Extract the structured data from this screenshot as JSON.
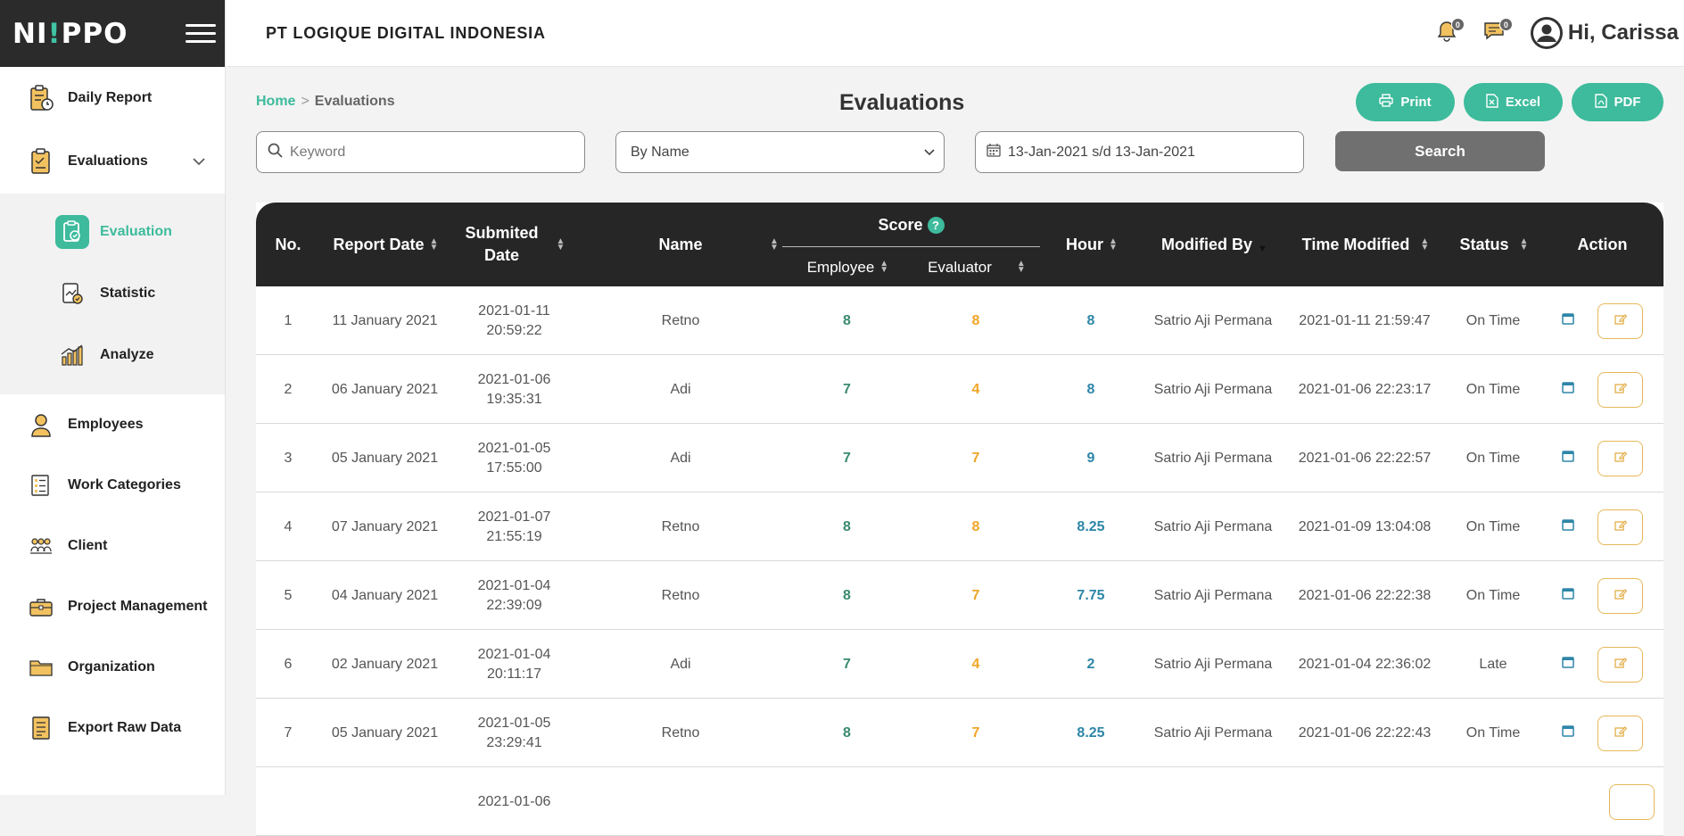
{
  "brand": {
    "logo_prefix": "NI",
    "logo_dot": "!",
    "logo_suffix": "PPO"
  },
  "sidebar": {
    "items": [
      {
        "label": "Daily Report"
      },
      {
        "label": "Evaluations"
      }
    ],
    "sub_items": [
      {
        "label": "Evaluation"
      },
      {
        "label": "Statistic"
      },
      {
        "label": "Analyze"
      }
    ],
    "lower_items": [
      {
        "label": "Employees"
      },
      {
        "label": "Work Categories"
      },
      {
        "label": "Client"
      },
      {
        "label": "Project Management"
      },
      {
        "label": "Organization"
      },
      {
        "label": "Export Raw Data"
      }
    ]
  },
  "header": {
    "company": "PT LOGIQUE DIGITAL INDONESIA",
    "notifications_count": "0",
    "messages_count": "0",
    "greeting": "Hi, Carissa"
  },
  "breadcrumb": {
    "home": "Home",
    "separator": ">",
    "current": "Evaluations"
  },
  "page": {
    "title": "Evaluations"
  },
  "exports": {
    "print": "Print",
    "excel": "Excel",
    "pdf": "PDF"
  },
  "filters": {
    "keyword_placeholder": "Keyword",
    "select_value": "By Name",
    "date_range": "13-Jan-2021 s/d 13-Jan-2021",
    "search_label": "Search"
  },
  "table": {
    "headers": {
      "no": "No.",
      "report_date": "Report Date",
      "submitted_date_1": "Submited",
      "submitted_date_2": "Date",
      "name": "Name",
      "score": "Score",
      "employee": "Employee",
      "evaluator": "Evaluator",
      "hour": "Hour",
      "modified_by": "Modified By",
      "time_modified": "Time Modified",
      "status": "Status",
      "action": "Action"
    },
    "rows": [
      {
        "no": "1",
        "report_date": "11 January 2021",
        "sub_date": "2021-01-11",
        "sub_time": "20:59:22",
        "name": "Retno",
        "employee": "8",
        "evaluator": "8",
        "hour": "8",
        "modified_by": "Satrio Aji Permana",
        "time_modified": "2021-01-11 21:59:47",
        "status": "On Time"
      },
      {
        "no": "2",
        "report_date": "06 January 2021",
        "sub_date": "2021-01-06",
        "sub_time": "19:35:31",
        "name": "Adi",
        "employee": "7",
        "evaluator": "4",
        "hour": "8",
        "modified_by": "Satrio Aji Permana",
        "time_modified": "2021-01-06 22:23:17",
        "status": "On Time"
      },
      {
        "no": "3",
        "report_date": "05 January 2021",
        "sub_date": "2021-01-05",
        "sub_time": "17:55:00",
        "name": "Adi",
        "employee": "7",
        "evaluator": "7",
        "hour": "9",
        "modified_by": "Satrio Aji Permana",
        "time_modified": "2021-01-06 22:22:57",
        "status": "On Time"
      },
      {
        "no": "4",
        "report_date": "07 January 2021",
        "sub_date": "2021-01-07",
        "sub_time": "21:55:19",
        "name": "Retno",
        "employee": "8",
        "evaluator": "8",
        "hour": "8.25",
        "modified_by": "Satrio Aji Permana",
        "time_modified": "2021-01-09 13:04:08",
        "status": "On Time"
      },
      {
        "no": "5",
        "report_date": "04 January 2021",
        "sub_date": "2021-01-04",
        "sub_time": "22:39:09",
        "name": "Retno",
        "employee": "8",
        "evaluator": "7",
        "hour": "7.75",
        "modified_by": "Satrio Aji Permana",
        "time_modified": "2021-01-06 22:22:38",
        "status": "On Time"
      },
      {
        "no": "6",
        "report_date": "02 January 2021",
        "sub_date": "2021-01-04",
        "sub_time": "20:11:17",
        "name": "Adi",
        "employee": "7",
        "evaluator": "4",
        "hour": "2",
        "modified_by": "Satrio Aji Permana",
        "time_modified": "2021-01-04 22:36:02",
        "status": "Late"
      },
      {
        "no": "7",
        "report_date": "05 January 2021",
        "sub_date": "2021-01-05",
        "sub_time": "23:29:41",
        "name": "Retno",
        "employee": "8",
        "evaluator": "7",
        "hour": "8.25",
        "modified_by": "Satrio Aji Permana",
        "time_modified": "2021-01-06 22:22:43",
        "status": "On Time"
      },
      {
        "no": "",
        "report_date": "",
        "sub_date": "2021-01-06",
        "sub_time": "",
        "name": "",
        "employee": "",
        "evaluator": "",
        "hour": "",
        "modified_by": "",
        "time_modified": "",
        "status": ""
      }
    ]
  },
  "colors": {
    "accent": "#3dbb9c",
    "sidebar_dark": "#2b2b2b",
    "table_header": "#262626",
    "employee_score": "#3a8a6e",
    "evaluator_score": "#f0a528",
    "hour": "#2e86a8",
    "search_button": "#707070"
  },
  "icons": {
    "daily_report": "clipboard-clock-icon",
    "evaluations": "clipboard-icon",
    "evaluation": "clipboard-check-icon",
    "statistic": "chart-doc-icon",
    "analyze": "bar-chart-icon",
    "employees": "person-icon",
    "work_categories": "list-icon",
    "client": "group-icon",
    "project_management": "briefcase-icon",
    "organization": "folder-icon",
    "export_raw_data": "document-icon",
    "view": "window-icon",
    "edit": "edit-icon"
  }
}
